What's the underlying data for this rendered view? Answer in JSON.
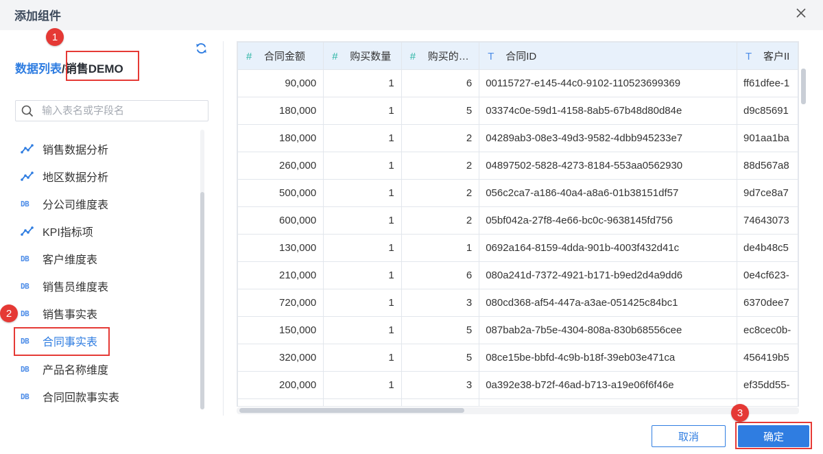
{
  "dialog": {
    "title": "添加组件",
    "close_icon": "close-icon"
  },
  "left_panel": {
    "breadcrumb_root": "数据列表",
    "breadcrumb_sep_current": "/销售DEMO",
    "refresh_icon": "refresh-icon",
    "search_placeholder": "输入表名或字段名",
    "items": [
      {
        "label": "销售数据分析",
        "icon": "line-chart-icon"
      },
      {
        "label": "地区数据分析",
        "icon": "line-chart-icon"
      },
      {
        "label": "分公司维度表",
        "icon": "db-icon"
      },
      {
        "label": "KPI指标项",
        "icon": "line-chart-icon"
      },
      {
        "label": "客户维度表",
        "icon": "db-icon"
      },
      {
        "label": "销售员维度表",
        "icon": "db-icon"
      },
      {
        "label": "销售事实表",
        "icon": "db-icon"
      },
      {
        "label": "合同事实表",
        "icon": "db-icon",
        "active": true
      },
      {
        "label": "产品名称维度",
        "icon": "db-icon"
      },
      {
        "label": "合同回款事实表",
        "icon": "db-icon"
      }
    ],
    "db_tag": "DB"
  },
  "table": {
    "columns": [
      {
        "type": "#",
        "label": "合同金额"
      },
      {
        "type": "#",
        "label": "购买数量"
      },
      {
        "type": "#",
        "label": "购买的…"
      },
      {
        "type": "T",
        "label": "合同ID"
      },
      {
        "type": "T",
        "label": "客户II"
      }
    ],
    "rows": [
      [
        "90,000",
        "1",
        "6",
        "00115727-e145-44c0-9102-110523699369",
        "ff61dfee-1"
      ],
      [
        "180,000",
        "1",
        "5",
        "03374c0e-59d1-4158-8ab5-67b48d80d84e",
        "d9c85691"
      ],
      [
        "180,000",
        "1",
        "2",
        "04289ab3-08e3-49d3-9582-4dbb945233e7",
        "901aa1ba"
      ],
      [
        "260,000",
        "1",
        "2",
        "04897502-5828-4273-8184-553aa0562930",
        "88d567a8"
      ],
      [
        "500,000",
        "1",
        "2",
        "056c2ca7-a186-40a4-a8a6-01b38151df57",
        "9d7ce8a7"
      ],
      [
        "600,000",
        "1",
        "2",
        "05bf042a-27f8-4e66-bc0c-9638145fd756",
        "74643073"
      ],
      [
        "130,000",
        "1",
        "1",
        "0692a164-8159-4dda-901b-4003f432d41c",
        "de4b48c5"
      ],
      [
        "210,000",
        "1",
        "6",
        "080a241d-7372-4921-b171-b9ed2d4a9dd6",
        "0e4cf623-"
      ],
      [
        "720,000",
        "1",
        "3",
        "080cd368-af54-447a-a3ae-051425c84bc1",
        "6370dee7"
      ],
      [
        "150,000",
        "1",
        "5",
        "087bab2a-7b5e-4304-808a-830b68556cee",
        "ec8cec0b-"
      ],
      [
        "320,000",
        "1",
        "5",
        "08ce15be-bbfd-4c9b-b18f-39eb03e471ca",
        "456419b5"
      ],
      [
        "200,000",
        "1",
        "3",
        "0a392e38-b72f-46ad-b713-a19e06f6f46e",
        "ef35dd55-"
      ],
      [
        "",
        "",
        "",
        "",
        ""
      ]
    ]
  },
  "footer": {
    "cancel_label": "取消",
    "ok_label": "确定"
  },
  "annotations": [
    {
      "number": "1",
      "target": "breadcrumb-current"
    },
    {
      "number": "2",
      "target": "tree-item-合同事实表"
    },
    {
      "number": "3",
      "target": "confirm-button"
    }
  ],
  "colors": {
    "accent": "#2f7de1",
    "annotation": "#e53935",
    "header_bg": "#e8f1fb",
    "number_type_icon": "#2bb5a4"
  }
}
